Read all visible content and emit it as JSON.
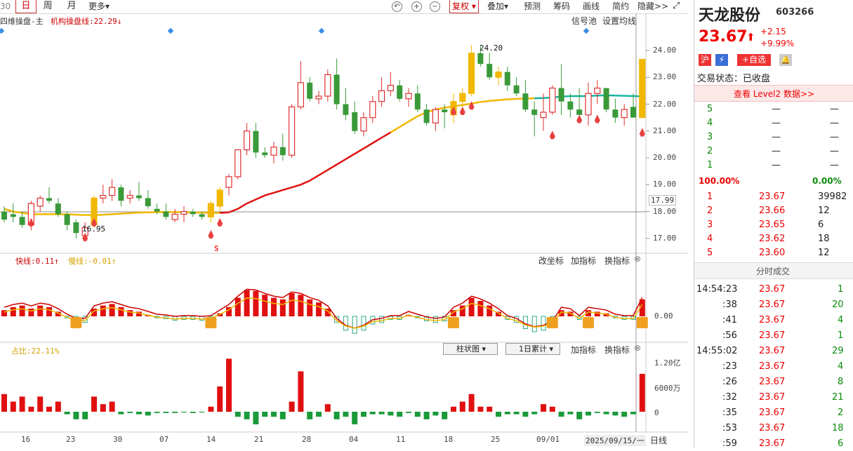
{
  "toolbar": {
    "period_prefix": "30",
    "tabs": [
      "日",
      "周",
      "月"
    ],
    "more": "更多▾",
    "btn_fuquan": "复权",
    "btn_diejia": "叠加",
    "btn_yuce": "预测",
    "btn_chouma": "筹码",
    "btn_huaxian": "画线",
    "btn_jianjie": "简约",
    "btn_yincang": "隐藏>>"
  },
  "main_panel": {
    "legend_name": "四维操盘-主",
    "legend_line": "机构操盘线:22.29↓",
    "btn_signal": "信号池",
    "btn_set_ma": "设置均线",
    "current_price_tag": "17.99",
    "high_label": "24.20",
    "low_label": "16.95",
    "signal_s": "S",
    "yticks": [
      "24.00",
      "23.00",
      "22.00",
      "21.00",
      "20.00",
      "19.00",
      "18.00",
      "17.00"
    ]
  },
  "macd_panel": {
    "fast": "快线:0.11↑",
    "slow": "慢线:-0.01↑",
    "btn_change_coord": "改坐标",
    "btn_add_indicator": "加指标",
    "btn_switch_indicator": "换指标",
    "ytick": "0.00"
  },
  "vol_panel": {
    "ratio": "占比:22.11%",
    "dropdown_chart": "柱状图",
    "dropdown_accum": "1日累计",
    "btn_add_indicator": "加指标",
    "btn_switch_indicator": "换指标",
    "yticks": [
      "1.20亿",
      "6000万",
      "0"
    ]
  },
  "xaxis": {
    "labels": [
      "16",
      "23",
      "30",
      "07",
      "14",
      "21",
      "28",
      "04",
      "11",
      "18",
      "25",
      "09/01"
    ],
    "current_date": "2025/09/15/一",
    "period": "日线"
  },
  "chart_data": {
    "type": "candlestick",
    "ylim": [
      16.5,
      24.6
    ],
    "candles": [
      [
        18.0,
        18.2,
        17.6,
        17.7
      ],
      [
        17.9,
        18.3,
        17.6,
        17.8
      ],
      [
        17.8,
        18.0,
        17.4,
        17.5
      ],
      [
        17.5,
        18.4,
        17.3,
        18.3
      ],
      [
        18.2,
        18.6,
        18.0,
        18.5
      ],
      [
        18.5,
        18.9,
        18.3,
        18.4
      ],
      [
        18.3,
        18.5,
        17.8,
        17.9
      ],
      [
        17.9,
        18.0,
        17.3,
        17.5
      ],
      [
        17.6,
        17.7,
        17.0,
        17.2
      ],
      [
        17.1,
        17.6,
        16.95,
        17.4
      ],
      [
        17.5,
        18.6,
        17.4,
        18.5
      ],
      [
        18.5,
        19.0,
        18.3,
        18.6
      ],
      [
        18.6,
        19.2,
        18.4,
        18.9
      ],
      [
        18.9,
        19.0,
        18.2,
        18.4
      ],
      [
        18.5,
        18.8,
        18.3,
        18.6
      ],
      [
        18.6,
        19.1,
        18.4,
        18.5
      ],
      [
        18.5,
        18.8,
        18.1,
        18.2
      ],
      [
        18.1,
        18.3,
        17.9,
        18.0
      ],
      [
        18.0,
        18.3,
        17.7,
        17.8
      ],
      [
        17.7,
        18.1,
        17.6,
        17.9
      ],
      [
        17.9,
        18.2,
        17.6,
        18.0
      ],
      [
        18.0,
        18.1,
        17.8,
        17.9
      ],
      [
        17.9,
        18.0,
        17.7,
        17.8
      ],
      [
        17.8,
        18.4,
        17.6,
        18.3
      ],
      [
        18.2,
        18.9,
        18.0,
        18.8
      ],
      [
        18.9,
        19.4,
        18.6,
        19.3
      ],
      [
        19.3,
        20.3,
        19.2,
        20.3
      ],
      [
        20.3,
        21.3,
        20.1,
        21.0
      ],
      [
        21.0,
        21.3,
        20.0,
        20.2
      ],
      [
        20.2,
        20.4,
        20.0,
        20.1
      ],
      [
        20.1,
        20.6,
        19.8,
        20.4
      ],
      [
        20.4,
        20.9,
        19.9,
        20.1
      ],
      [
        20.1,
        22.0,
        20.0,
        21.9
      ],
      [
        21.9,
        23.6,
        21.8,
        22.8
      ],
      [
        22.8,
        23.0,
        22.1,
        22.2
      ],
      [
        22.2,
        22.5,
        22.0,
        22.3
      ],
      [
        22.3,
        23.3,
        22.1,
        23.1
      ],
      [
        23.1,
        23.7,
        21.8,
        22.0
      ],
      [
        22.0,
        22.6,
        21.4,
        21.6
      ],
      [
        21.7,
        22.1,
        20.9,
        21.0
      ],
      [
        21.0,
        21.7,
        20.8,
        21.5
      ],
      [
        21.5,
        22.3,
        21.3,
        22.1
      ],
      [
        22.1,
        23.0,
        21.9,
        22.5
      ],
      [
        22.5,
        23.2,
        22.3,
        22.7
      ],
      [
        22.7,
        22.9,
        22.1,
        22.2
      ],
      [
        22.2,
        22.6,
        21.9,
        22.4
      ],
      [
        22.4,
        22.7,
        21.7,
        21.8
      ],
      [
        21.8,
        22.0,
        21.2,
        21.3
      ],
      [
        21.3,
        21.9,
        21.0,
        21.8
      ],
      [
        21.8,
        22.0,
        21.1,
        21.7
      ],
      [
        21.6,
        22.4,
        21.3,
        22.1
      ],
      [
        22.1,
        22.6,
        21.9,
        22.4
      ],
      [
        22.4,
        24.2,
        22.3,
        23.9
      ],
      [
        23.9,
        24.2,
        23.4,
        23.5
      ],
      [
        23.5,
        23.9,
        22.9,
        23.0
      ],
      [
        23.0,
        23.4,
        22.7,
        23.2
      ],
      [
        23.2,
        23.4,
        22.5,
        22.7
      ],
      [
        22.7,
        23.0,
        22.3,
        22.4
      ],
      [
        22.4,
        22.9,
        21.7,
        21.8
      ],
      [
        21.8,
        22.1,
        20.8,
        21.6
      ],
      [
        21.5,
        22.4,
        21.0,
        21.7
      ],
      [
        21.7,
        22.7,
        21.6,
        22.6
      ],
      [
        22.6,
        23.5,
        21.6,
        22.1
      ],
      [
        22.1,
        22.4,
        21.5,
        21.8
      ],
      [
        21.8,
        22.6,
        21.3,
        21.6
      ],
      [
        21.6,
        22.8,
        21.2,
        22.4
      ],
      [
        22.4,
        22.9,
        22.0,
        22.6
      ],
      [
        22.6,
        22.6,
        21.7,
        21.8
      ],
      [
        21.8,
        22.2,
        21.3,
        21.5
      ],
      [
        21.5,
        22.0,
        21.2,
        21.8
      ],
      [
        21.9,
        22.4,
        21.5,
        21.5
      ],
      [
        21.5,
        23.67,
        21.5,
        23.67
      ]
    ],
    "trend_line": [
      18.1,
      18.0,
      17.95,
      17.9,
      17.9,
      17.9,
      17.9,
      17.9,
      17.88,
      17.87,
      17.87,
      17.88,
      17.9,
      17.92,
      17.94,
      17.96,
      17.97,
      17.98,
      17.98,
      17.98,
      17.98,
      17.97,
      17.96,
      17.95,
      17.95,
      17.97,
      18.1,
      18.3,
      18.45,
      18.6,
      18.7,
      18.8,
      18.9,
      19.0,
      19.15,
      19.35,
      19.55,
      19.75,
      19.95,
      20.15,
      20.35,
      20.55,
      20.75,
      20.95,
      21.15,
      21.35,
      21.55,
      21.7,
      21.8,
      21.87,
      21.92,
      21.97,
      22.02,
      22.08,
      22.12,
      22.15,
      22.18,
      22.2,
      22.21,
      22.22,
      22.23,
      22.25,
      22.28,
      22.3,
      22.3,
      22.3,
      22.32,
      22.33,
      22.32,
      22.31,
      22.3,
      22.29
    ],
    "macd_bars": [
      0.08,
      0.12,
      0.14,
      0.1,
      0.14,
      0.12,
      0.06,
      -0.02,
      -0.08,
      -0.08,
      0.1,
      0.14,
      0.16,
      0.12,
      0.08,
      0.06,
      0.02,
      -0.02,
      -0.03,
      -0.05,
      -0.04,
      -0.04,
      -0.05,
      -0.04,
      0.04,
      0.12,
      0.24,
      0.34,
      0.33,
      0.28,
      0.24,
      0.22,
      0.3,
      0.28,
      0.22,
      0.18,
      0.1,
      -0.08,
      -0.18,
      -0.22,
      -0.18,
      -0.1,
      -0.08,
      -0.04,
      -0.04,
      0.02,
      -0.02,
      -0.06,
      -0.08,
      -0.06,
      0.08,
      0.14,
      0.24,
      0.2,
      0.14,
      0.06,
      -0.04,
      -0.08,
      -0.16,
      -0.2,
      -0.18,
      -0.12,
      0.08,
      0.06,
      -0.04,
      0.08,
      0.06,
      0.04,
      -0.02,
      -0.04,
      -0.04,
      0.22
    ],
    "vol_bars": [
      0.35,
      0.2,
      0.3,
      0.1,
      0.3,
      0.1,
      0.2,
      -0.1,
      -0.3,
      -0.3,
      0.3,
      0.15,
      0.2,
      -0.1,
      -0.05,
      -0.1,
      -0.15,
      -0.05,
      -0.05,
      -0.05,
      -0.03,
      -0.05,
      -0.03,
      0.1,
      0.5,
      1.05,
      -0.2,
      -0.3,
      -0.5,
      -0.2,
      -0.2,
      -0.3,
      0.2,
      0.8,
      -0.3,
      -0.2,
      0.15,
      -0.3,
      -0.2,
      -0.5,
      -0.2,
      -0.1,
      -0.1,
      -0.15,
      -0.2,
      -0.05,
      -0.2,
      -0.3,
      -0.15,
      -0.3,
      0.1,
      0.2,
      0.35,
      0.1,
      0.1,
      -0.2,
      -0.1,
      -0.1,
      -0.2,
      -0.1,
      0.15,
      0.1,
      -0.2,
      -0.1,
      -0.3,
      -0.15,
      -0.05,
      -0.1,
      -0.15,
      -0.2,
      -0.1,
      0.75
    ]
  },
  "quote": {
    "name": "天龙股份",
    "code": "603266",
    "price": "23.67",
    "arrow": "⬆",
    "change": "+2.15",
    "pct": "+9.99%",
    "tag_hu": "沪",
    "tag_add": "+自选",
    "status": "交易状态：已收盘",
    "level2": "查看 Level2 数据>>",
    "sell_rows": [
      [
        "5",
        "—",
        "—"
      ],
      [
        "4",
        "—",
        "—"
      ],
      [
        "3",
        "—",
        "—"
      ],
      [
        "2",
        "—",
        "—"
      ],
      [
        "1",
        "—",
        "—"
      ]
    ],
    "ratio_left": "100.00%",
    "ratio_right": "0.00%",
    "buy_rows": [
      [
        "1",
        "23.67",
        "39982"
      ],
      [
        "2",
        "23.66",
        "12"
      ],
      [
        "3",
        "23.65",
        "6"
      ],
      [
        "4",
        "23.62",
        "18"
      ],
      [
        "5",
        "23.60",
        "12"
      ]
    ],
    "ticks_title": "分时成交",
    "ticks": [
      [
        "14:54:23",
        "23.67",
        "1"
      ],
      [
        ":38",
        "23.67",
        "20"
      ],
      [
        ":41",
        "23.67",
        "4"
      ],
      [
        ":56",
        "23.67",
        "1"
      ],
      [
        "14:55:02",
        "23.67",
        "29"
      ],
      [
        ":23",
        "23.67",
        "4"
      ],
      [
        ":26",
        "23.67",
        "8"
      ],
      [
        ":32",
        "23.67",
        "21"
      ],
      [
        ":35",
        "23.67",
        "2"
      ],
      [
        ":53",
        "23.67",
        "18"
      ],
      [
        ":59",
        "23.67",
        "6"
      ]
    ]
  }
}
